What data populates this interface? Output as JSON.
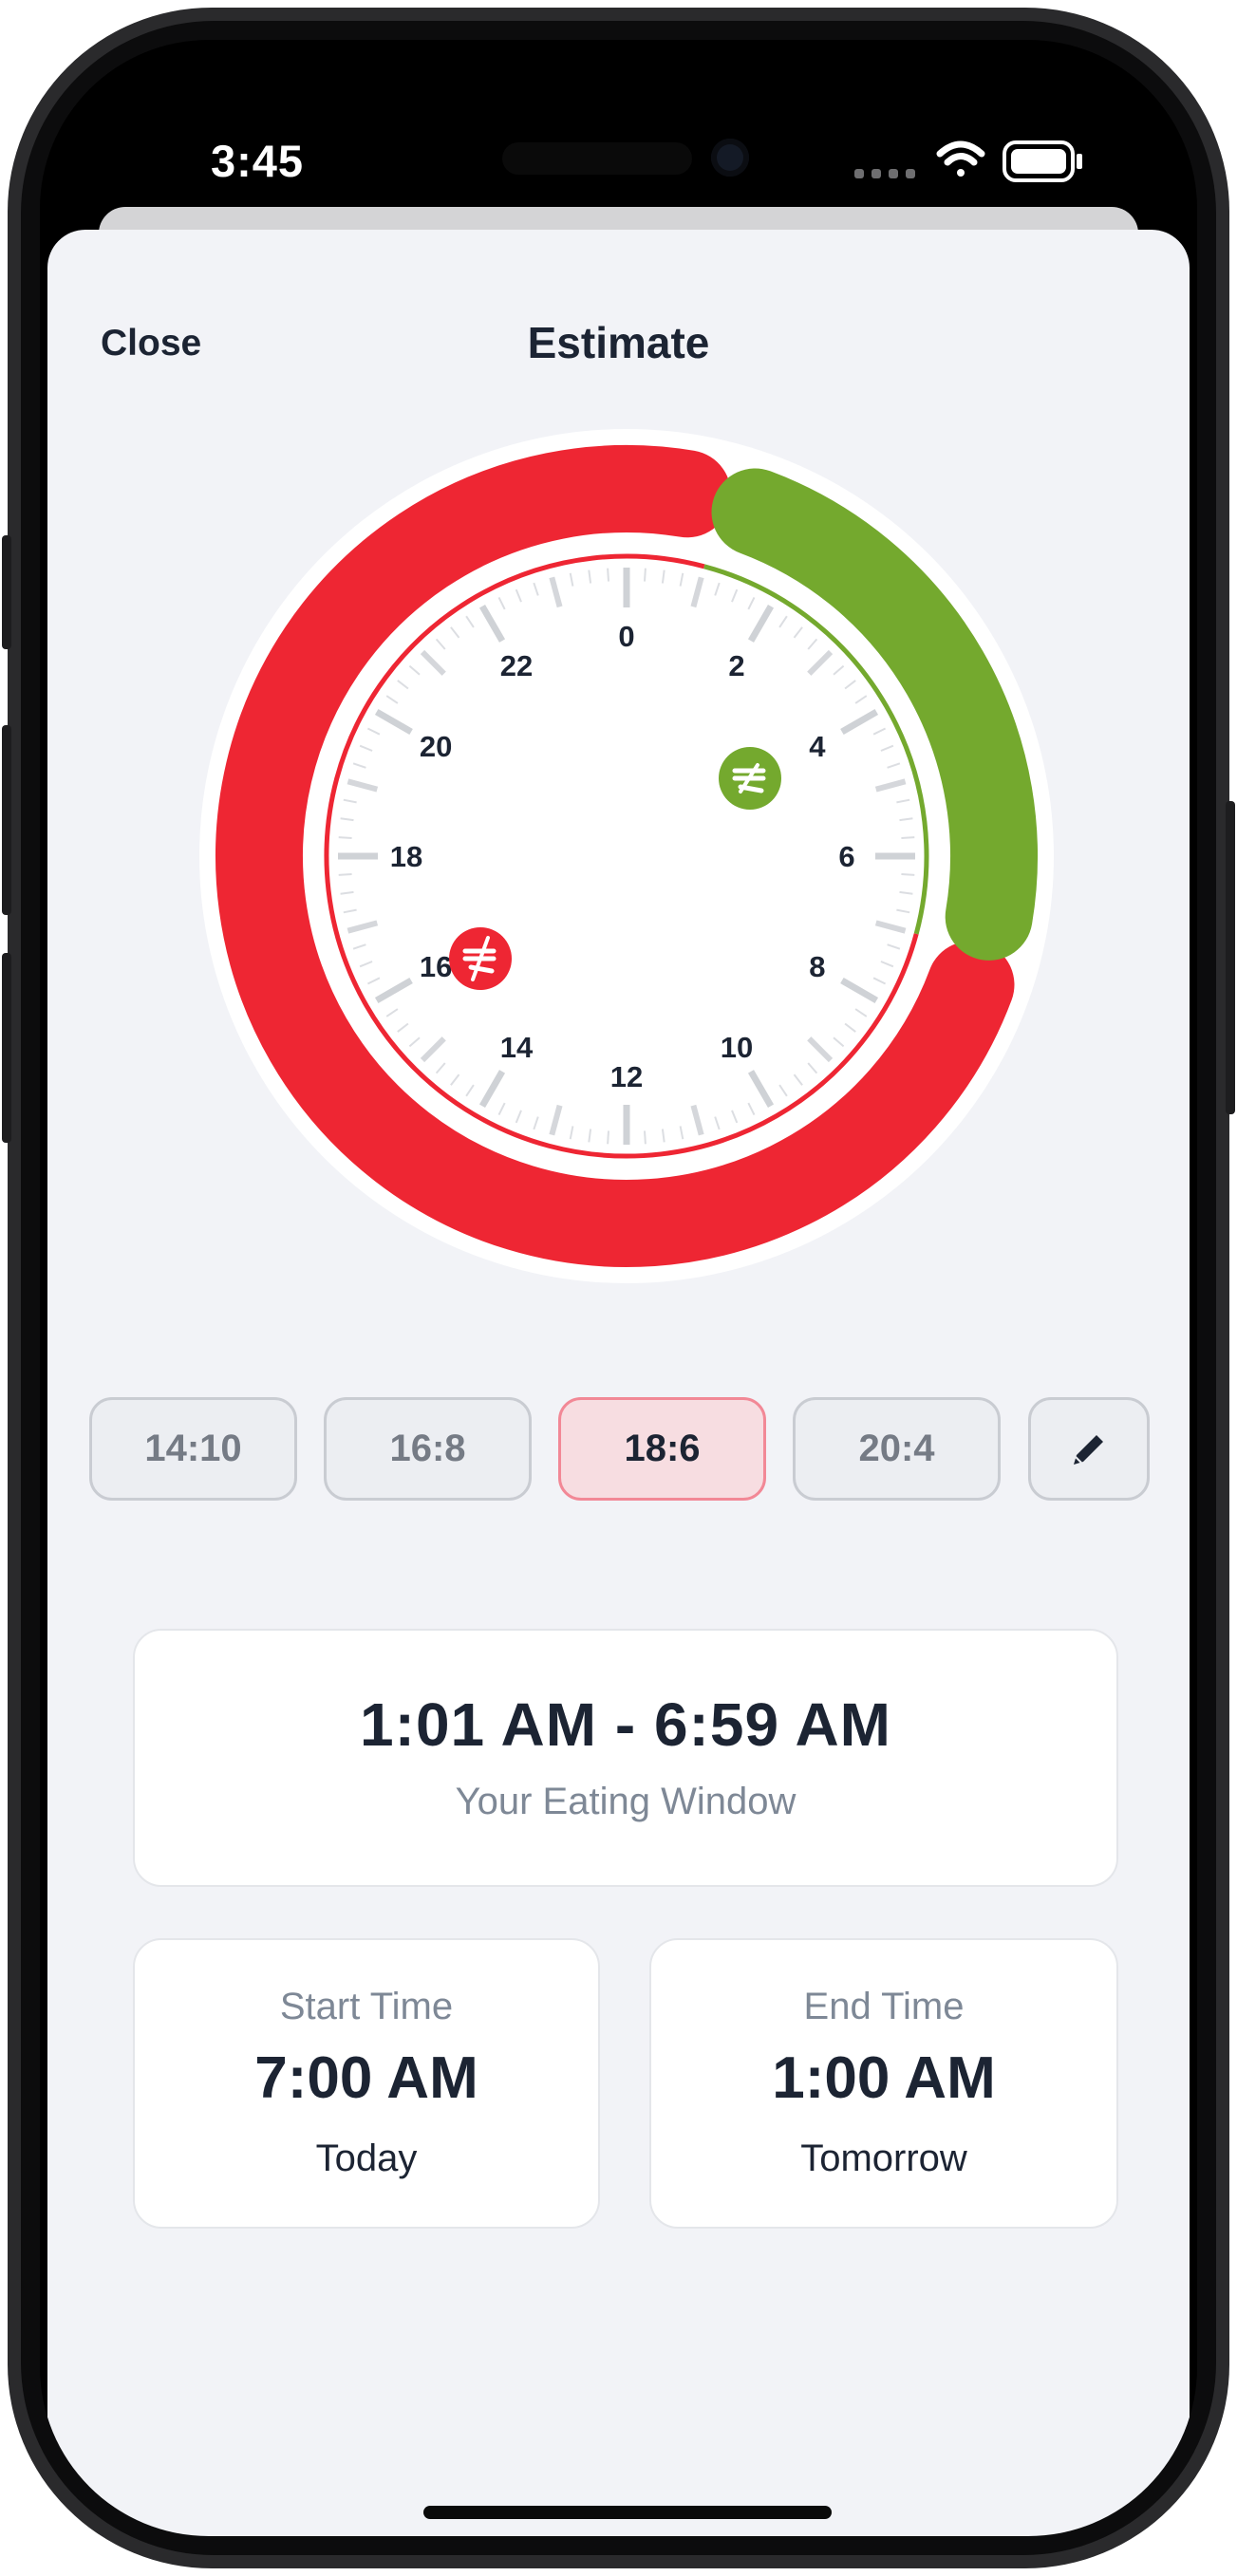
{
  "status_bar": {
    "time": "3:45",
    "icons": [
      "signal-dots-icon",
      "wifi-icon",
      "battery-icon"
    ]
  },
  "header": {
    "close_label": "Close",
    "title": "Estimate"
  },
  "dial": {
    "hour_labels": [
      "0",
      "2",
      "4",
      "6",
      "8",
      "10",
      "12",
      "14",
      "16",
      "18",
      "20",
      "22"
    ],
    "fasting_color": "#ee2633",
    "eating_color": "#74a92e",
    "eating_start_hour": 1,
    "eating_end_hour": 7,
    "icons": [
      "eat-start-icon",
      "fast-start-icon"
    ]
  },
  "presets": {
    "options": [
      "14:10",
      "16:8",
      "18:6",
      "20:4"
    ],
    "selected": "18:6",
    "edit_icon": "pencil-icon"
  },
  "eating_window": {
    "range": "1:01 AM - 6:59 AM",
    "label": "Your Eating Window"
  },
  "start": {
    "label": "Start Time",
    "time": "7:00 AM",
    "day": "Today"
  },
  "end": {
    "label": "End Time",
    "time": "1:00 AM",
    "day": "Tomorrow"
  }
}
